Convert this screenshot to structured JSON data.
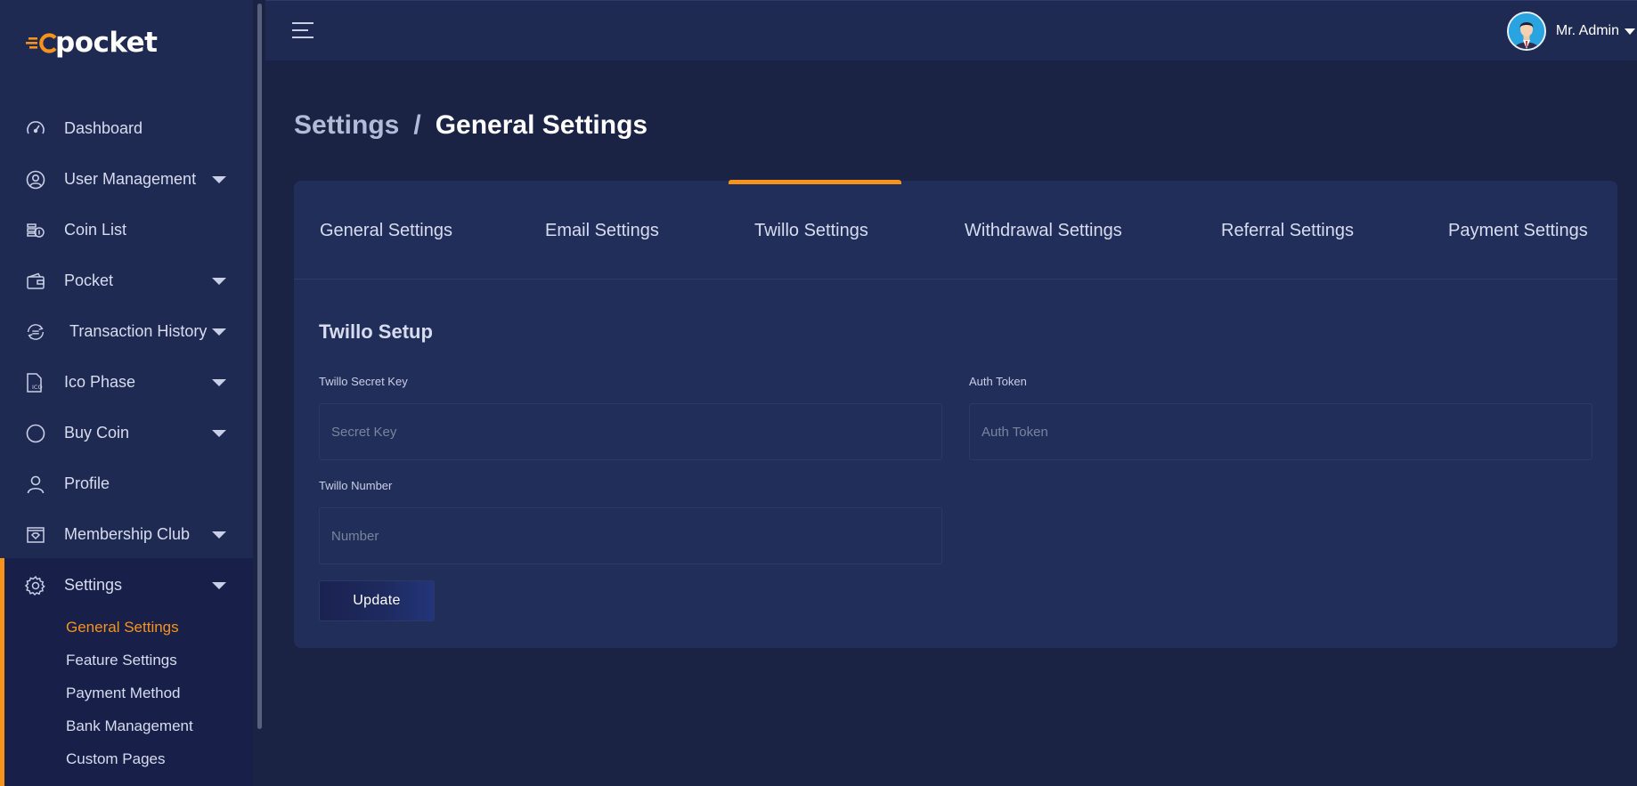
{
  "brand": {
    "logo_text": "pocket",
    "accent": "#f7931a"
  },
  "topbar": {
    "menu_icon": "hamburger-icon",
    "user_name": "Mr. Admin"
  },
  "sidebar": {
    "items": [
      {
        "label": "Dashboard",
        "icon": "speedometer-icon",
        "has_caret": false
      },
      {
        "label": "User Management",
        "icon": "user-circle-icon",
        "has_caret": true
      },
      {
        "label": "Coin List",
        "icon": "coins-icon",
        "has_caret": false
      },
      {
        "label": "Pocket",
        "icon": "wallet-icon",
        "has_caret": true
      },
      {
        "label": "Transaction History",
        "icon": "transfer-icon",
        "has_caret": true
      },
      {
        "label": "Ico Phase",
        "icon": "ico-file-icon",
        "has_caret": true
      },
      {
        "label": "Buy Coin",
        "icon": "circle-icon",
        "has_caret": true
      },
      {
        "label": "Profile",
        "icon": "user-icon",
        "has_caret": false
      },
      {
        "label": "Membership Club",
        "icon": "membership-icon",
        "has_caret": true
      },
      {
        "label": "Settings",
        "icon": "gear-icon",
        "has_caret": true
      }
    ],
    "sub_items": [
      {
        "label": "General Settings",
        "active": true
      },
      {
        "label": "Feature Settings",
        "active": false
      },
      {
        "label": "Payment Method",
        "active": false
      },
      {
        "label": "Bank Management",
        "active": false
      },
      {
        "label": "Custom Pages",
        "active": false
      }
    ]
  },
  "breadcrumb": {
    "parent": "Settings",
    "separator": "/",
    "current": "General Settings"
  },
  "tabs": [
    {
      "label": "General Settings"
    },
    {
      "label": "Email Settings"
    },
    {
      "label": "Twillo Settings",
      "active": true
    },
    {
      "label": "Withdrawal Settings"
    },
    {
      "label": "Referral Settings"
    },
    {
      "label": "Payment Settings"
    }
  ],
  "form": {
    "title": "Twillo Setup",
    "secret_key": {
      "label": "Twillo Secret Key",
      "placeholder": "Secret Key",
      "value": ""
    },
    "auth_token": {
      "label": "Auth Token",
      "placeholder": "Auth Token",
      "value": ""
    },
    "number": {
      "label": "Twillo Number",
      "placeholder": "Number",
      "value": ""
    },
    "submit_label": "Update"
  }
}
